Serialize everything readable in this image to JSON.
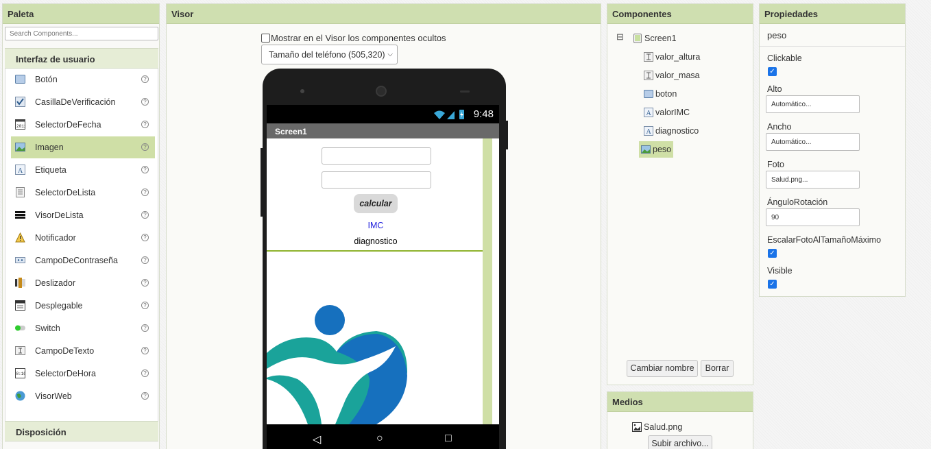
{
  "palette": {
    "title": "Paleta",
    "search_placeholder": "Search Components...",
    "category_ui": "Interfaz de usuario",
    "category_layout": "Disposición",
    "items": [
      {
        "label": "Botón",
        "icon": "button-icon"
      },
      {
        "label": "CasillaDeVerificación",
        "icon": "checkbox-icon"
      },
      {
        "label": "SelectorDeFecha",
        "icon": "calendar-icon"
      },
      {
        "label": "Imagen",
        "icon": "image-icon",
        "selected": true
      },
      {
        "label": "Etiqueta",
        "icon": "label-icon"
      },
      {
        "label": "SelectorDeLista",
        "icon": "listpicker-icon"
      },
      {
        "label": "VisorDeLista",
        "icon": "listview-icon"
      },
      {
        "label": "Notificador",
        "icon": "warning-icon"
      },
      {
        "label": "CampoDeContraseña",
        "icon": "password-icon"
      },
      {
        "label": "Deslizador",
        "icon": "slider-icon"
      },
      {
        "label": "Desplegable",
        "icon": "spinner-icon"
      },
      {
        "label": "Switch",
        "icon": "switch-icon"
      },
      {
        "label": "CampoDeTexto",
        "icon": "textbox-icon"
      },
      {
        "label": "SelectorDeHora",
        "icon": "clock-icon"
      },
      {
        "label": "VisorWeb",
        "icon": "globe-icon"
      }
    ],
    "help_glyph": "?"
  },
  "visor": {
    "title": "Visor",
    "show_hidden_label": "Mostrar en el Visor los componentes ocultos",
    "size_select": "Tamaño del teléfono (505,320)",
    "phone": {
      "time": "9:48",
      "screen_title": "Screen1",
      "button_label": "calcular",
      "imc_label": "IMC",
      "diag_label": "diagnostico"
    }
  },
  "components": {
    "title": "Componentes",
    "tree": [
      {
        "label": "Screen1",
        "icon": "screen-icon"
      },
      {
        "label": "valor_altura",
        "icon": "textbox-icon"
      },
      {
        "label": "valor_masa",
        "icon": "textbox-icon"
      },
      {
        "label": "boton",
        "icon": "button-icon"
      },
      {
        "label": "valorIMC",
        "icon": "label-icon"
      },
      {
        "label": "diagnostico",
        "icon": "label-icon"
      },
      {
        "label": "peso",
        "icon": "image-icon",
        "selected": true
      }
    ],
    "rename_button": "Cambiar nombre",
    "delete_button": "Borrar",
    "collapse_glyph": "⊟"
  },
  "media": {
    "title": "Medios",
    "files": [
      "Salud.png"
    ],
    "upload_button": "Subir archivo..."
  },
  "properties": {
    "title": "Propiedades",
    "component_name": "peso",
    "clickable_label": "Clickable",
    "clickable": true,
    "alto_label": "Alto",
    "alto_value": "Automático...",
    "ancho_label": "Ancho",
    "ancho_value": "Automático...",
    "foto_label": "Foto",
    "foto_value": "Salud.png...",
    "angulo_label": "ÁnguloRotación",
    "angulo_value": "90",
    "escalar_label": "EscalarFotoAlTamañoMáximo",
    "escalar": true,
    "visible_label": "Visible",
    "visible": true
  },
  "colors": {
    "panel_header": "#cfdfb0",
    "selected": "#cfdfa6",
    "accent_line": "#8eb32c",
    "logo_teal": "#1aa39a",
    "logo_blue": "#1670be",
    "label_blue": "#2222dd"
  }
}
